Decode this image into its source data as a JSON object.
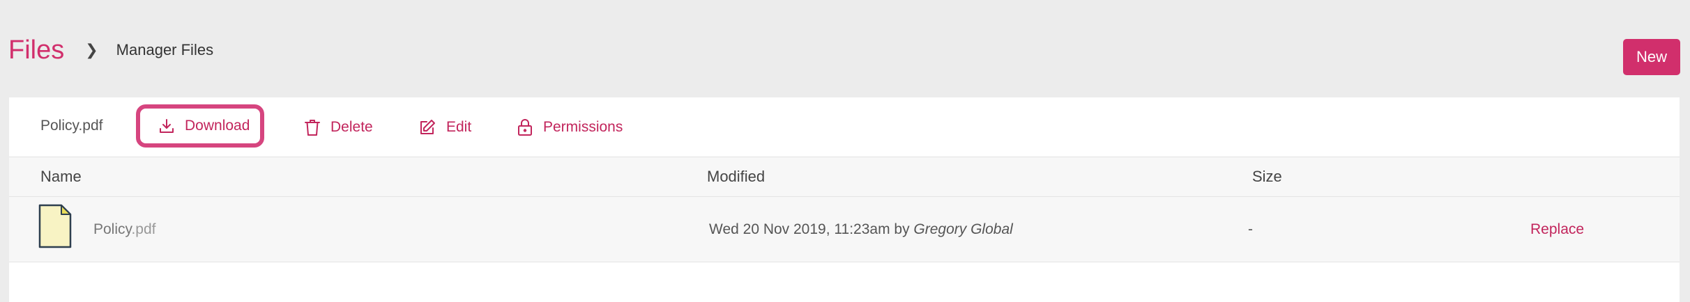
{
  "header": {
    "breadcrumb_root": "Files",
    "breadcrumb_separator": "❯",
    "breadcrumb_current": "Manager Files",
    "new_button_label": "New"
  },
  "toolbar": {
    "selected_file": "Policy.pdf",
    "actions": [
      {
        "label": "Download",
        "icon": "download-icon",
        "highlighted": true
      },
      {
        "label": "Delete",
        "icon": "trash-icon"
      },
      {
        "label": "Edit",
        "icon": "edit-icon"
      },
      {
        "label": "Permissions",
        "icon": "lock-icon"
      }
    ]
  },
  "table": {
    "columns": [
      "Name",
      "Modified",
      "Size"
    ],
    "rows": [
      {
        "icon": "pdf-file-icon",
        "name_base": "Policy",
        "name_ext": ".pdf",
        "modified": "Wed 20 Nov 2019, 11:23am by ",
        "modified_by": "Gregory Global",
        "size": "-",
        "action": "Replace"
      }
    ]
  },
  "colors": {
    "accent": "#d12f6c",
    "link": "#c2255c",
    "highlight_border": "#d6457f",
    "page_bg": "#ececec",
    "file_icon_fill": "#f8f3c4",
    "file_icon_corner": "#e8dc5a"
  }
}
